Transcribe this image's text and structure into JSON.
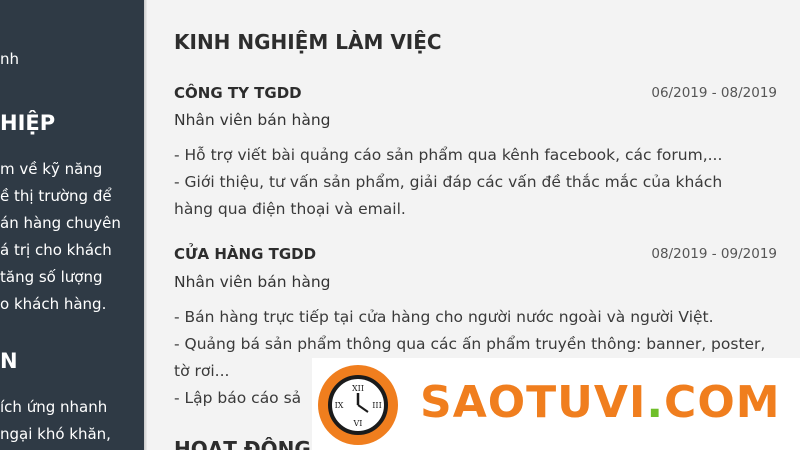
{
  "sidebar": {
    "frag1": "nh",
    "section1_title": "HIỆP",
    "section1_lines": [
      "m về kỹ năng",
      "ề thị trường để",
      "án hàng chuyên",
      "á trị cho khách",
      "tăng số lượng",
      "o khách hàng."
    ],
    "section2_title": "N",
    "section2_lines": [
      "ích ứng nhanh",
      "ngại khó khăn,"
    ]
  },
  "main": {
    "heading": "KINH NGHIỆM LÀM VIỆC",
    "jobs": [
      {
        "company": "CÔNG TY TGDD",
        "date": "06/2019 - 08/2019",
        "role": "Nhân viên bán hàng",
        "bullets": [
          "- Hỗ trợ viết bài quảng cáo sản phẩm qua kênh facebook, các forum,...",
          "- Giới thiệu, tư vấn sản phẩm, giải đáp các vấn đề thắc mắc của khách",
          "hàng qua điện thoại và email."
        ]
      },
      {
        "company": "CỬA HÀNG TGDD",
        "date": "08/2019 - 09/2019",
        "role": "Nhân viên bán hàng",
        "bullets": [
          "- Bán hàng trực tiếp tại cửa hàng cho người nước ngoài và người Việt.",
          "- Quảng bá sản phẩm thông qua các ấn phẩm truyền thông: banner, poster,",
          "tờ rơi...",
          "- Lập báo cáo sả"
        ]
      }
    ],
    "next_heading": "HOẠT ĐỘNG"
  },
  "watermark": {
    "text": "SAOTUVI",
    "dot": ".",
    "tld": "COM"
  },
  "colors": {
    "sidebar_bg": "#2f3a45",
    "brand_orange": "#f07e1e",
    "brand_green": "#6fbf2a"
  }
}
